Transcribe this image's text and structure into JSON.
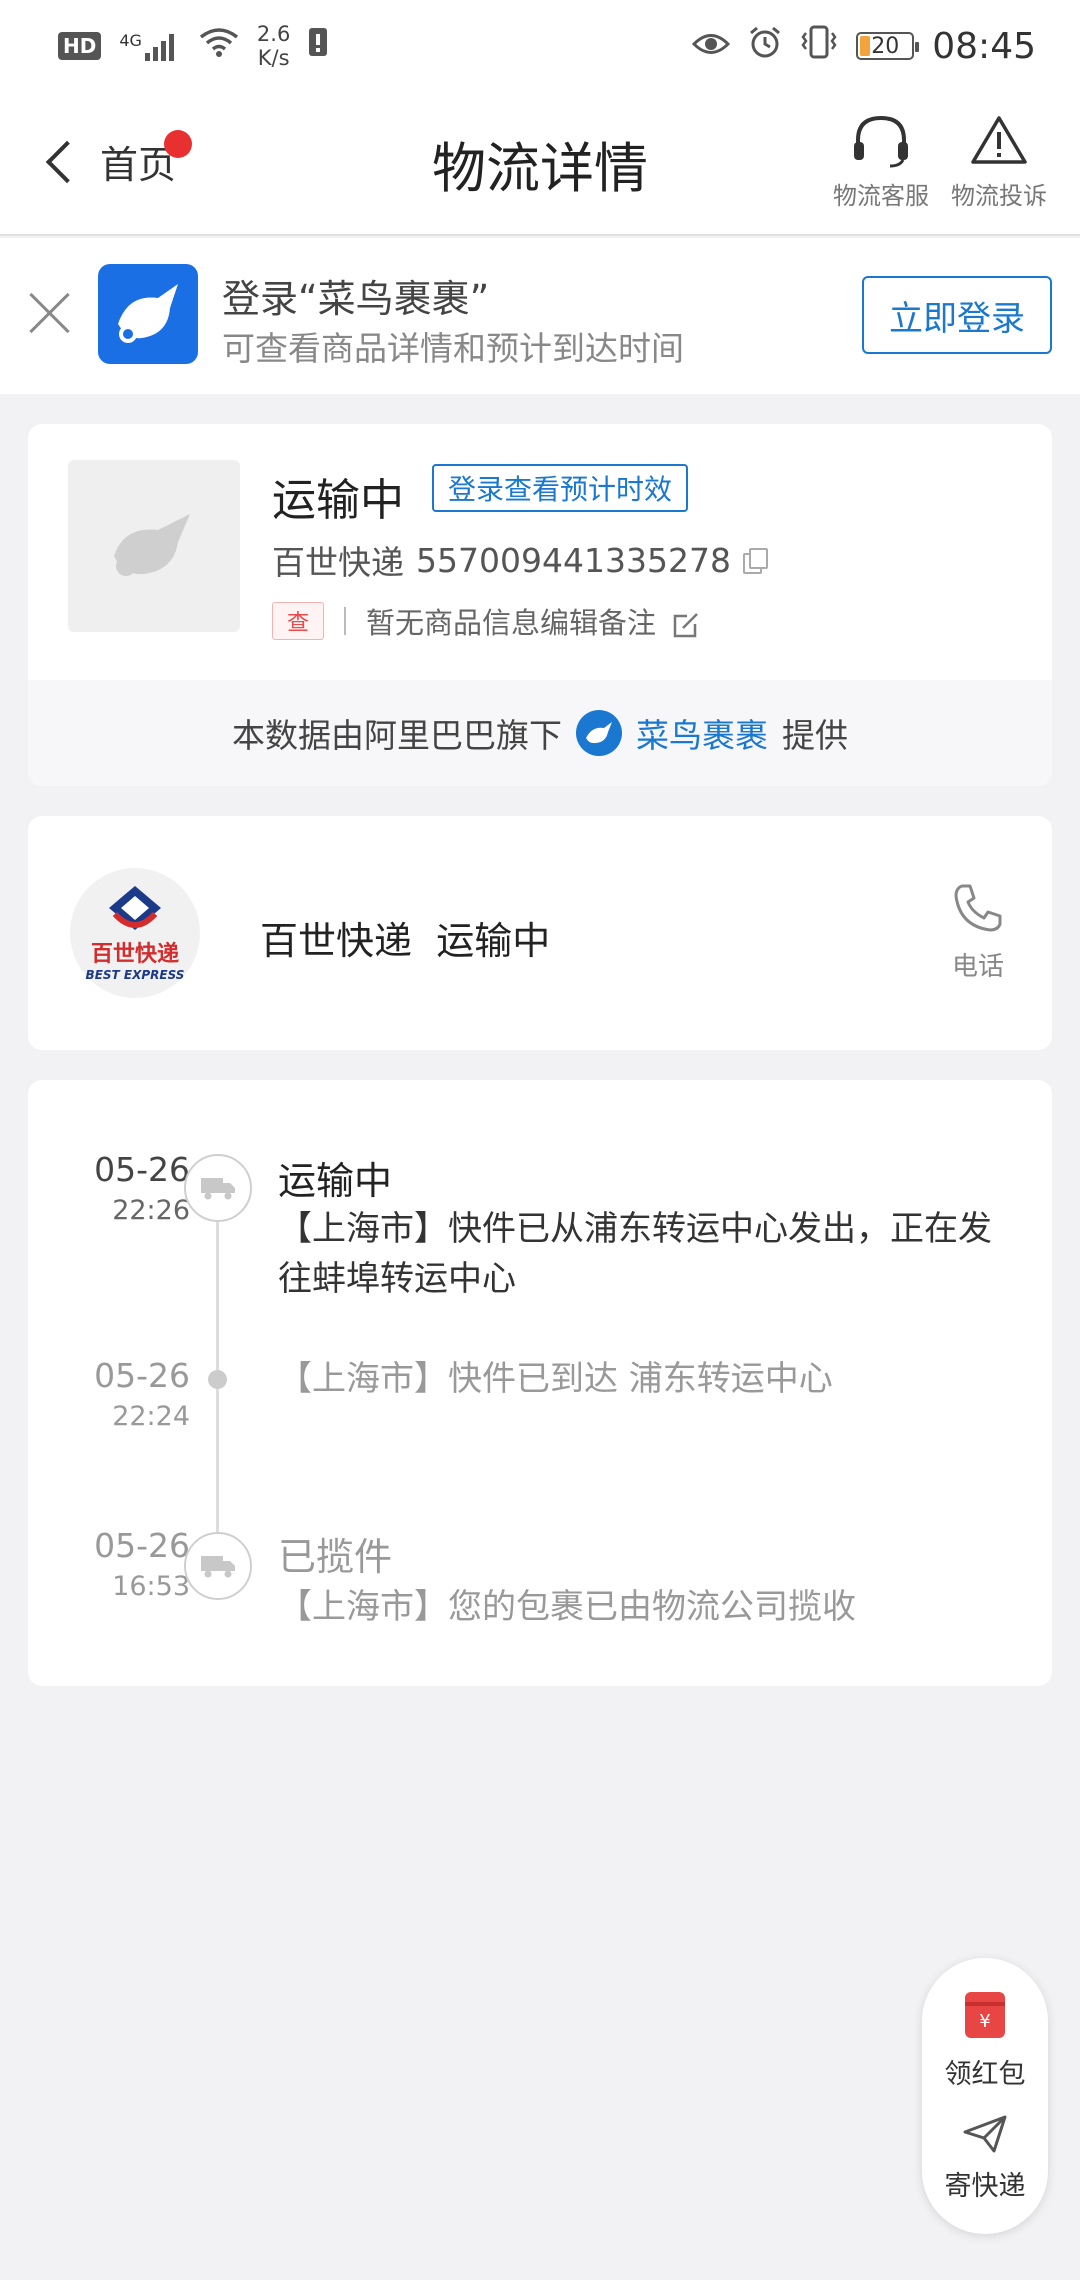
{
  "statusbar": {
    "hd": "HD",
    "net": "4G",
    "speed_value": "2.6",
    "speed_unit": "K/s",
    "battery": "20",
    "time": "08:45"
  },
  "header": {
    "back_label": "首页",
    "title": "物流详情",
    "service_label": "物流客服",
    "complain_label": "物流投诉"
  },
  "login_banner": {
    "title": "登录“菜鸟裹裹”",
    "subtitle": "可查看商品详情和预计到达时间",
    "button": "立即登录"
  },
  "package": {
    "status": "运输中",
    "eta_tag": "登录查看预计时效",
    "carrier": "百世快递",
    "tracking_number": "557009441335278",
    "check_badge": "查",
    "item_info": "暂无商品信息编辑备注",
    "provided_prefix": "本数据由阿里巴巴旗下",
    "provided_brand": "菜鸟裹裹",
    "provided_suffix": "提供"
  },
  "carrier_card": {
    "logo_cn": "百世快递",
    "logo_en": "BEST EXPRESS",
    "carrier": "百世快递",
    "status": "运输中",
    "phone_label": "电话"
  },
  "timeline": [
    {
      "date": "05-26",
      "time": "22:26",
      "title": "运输中",
      "desc": "【上海市】快件已从浦东转运中心发出，正在发往蚌埠转运中心",
      "icon": "truck-icon"
    },
    {
      "date": "05-26",
      "time": "22:24",
      "title": "",
      "desc": "【上海市】快件已到达 浦东转运中心",
      "icon": "dot"
    },
    {
      "date": "05-26",
      "time": "16:53",
      "title": "已揽件",
      "desc": "【上海市】您的包裹已由物流公司揽收",
      "icon": "truck-icon"
    }
  ],
  "floating": {
    "redpacket_label": "领红包",
    "redpacket_symbol": "¥",
    "send_label": "寄快递"
  },
  "colors": {
    "accent": "#1a78d0",
    "background": "#f2f2f4",
    "badge_red": "#e83030"
  }
}
